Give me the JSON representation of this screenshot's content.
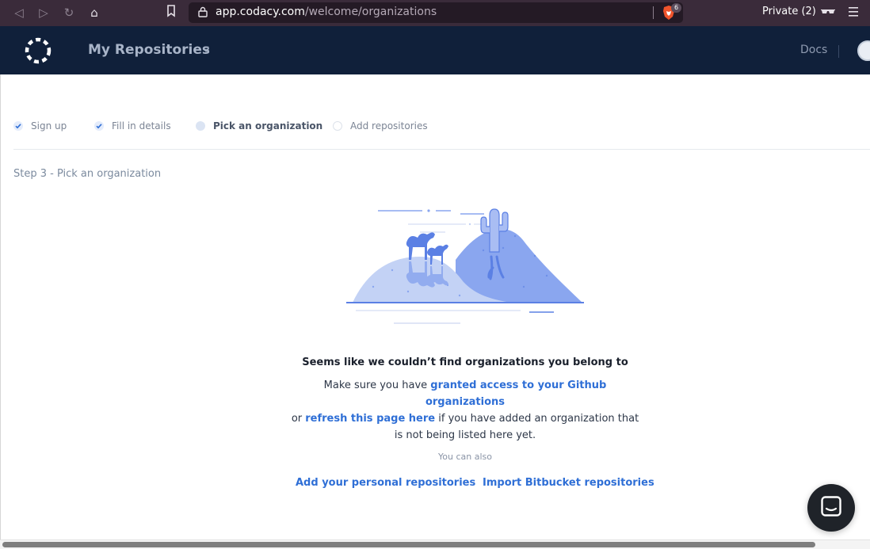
{
  "browser": {
    "url_domain": "app.codacy.com",
    "url_path": "/welcome/organizations",
    "shields_count": "6",
    "private_label": "Private (2)"
  },
  "header": {
    "title": "My Repositories",
    "docs_label": "Docs"
  },
  "steps": [
    {
      "label": "Sign up",
      "state": "done"
    },
    {
      "label": "Fill in details",
      "state": "done"
    },
    {
      "label": "Pick an organization",
      "state": "active"
    },
    {
      "label": "Add repositories",
      "state": "pending"
    }
  ],
  "step_title": "Step 3 - Pick an organization",
  "empty_state": {
    "heading": "Seems like we couldn’t find organizations you belong to",
    "line_prefix": "Make sure you have ",
    "link_granted": "granted access to your Github organizations",
    "line_or": "or ",
    "link_refresh": "refresh this page here",
    "line_suffix": " if you have added an organization that is not being listed here yet."
  },
  "also_label": "You can also",
  "actions": {
    "personal": "Add your personal repositories",
    "bitbucket": "Import Bitbucket repositories"
  },
  "colors": {
    "header_bg": "#10203a",
    "link": "#2f6fd6",
    "illustration_light": "#c3d2f5",
    "illustration_mid": "#8aa6ef",
    "illustration_dark": "#5b80e4"
  }
}
